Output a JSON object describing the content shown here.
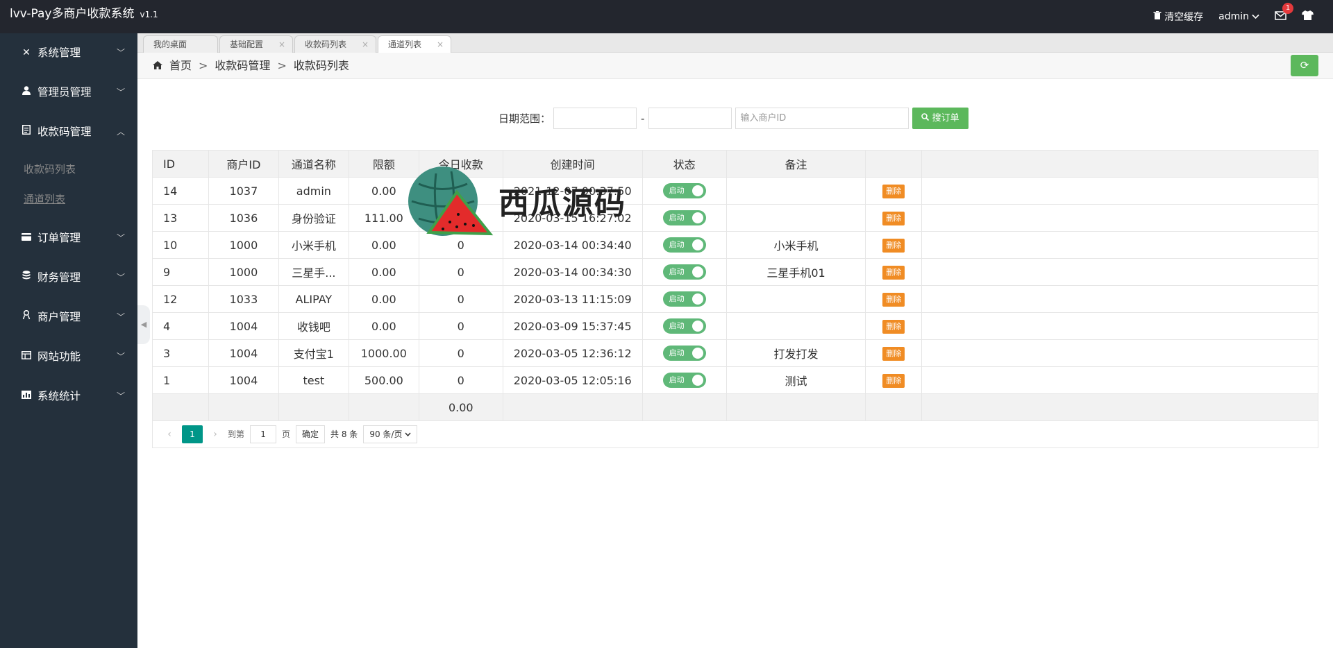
{
  "header": {
    "title": "lvv-Pay多商户收款系统",
    "version": "v1.1",
    "clear_cache": "清空缓存",
    "user": "admin",
    "mail_badge": "1"
  },
  "sidebar": {
    "items": [
      {
        "label": "系统管理",
        "icon": "wrench-icon"
      },
      {
        "label": "管理员管理",
        "icon": "user-icon"
      },
      {
        "label": "收款码管理",
        "icon": "list-icon"
      },
      {
        "label": "订单管理",
        "icon": "card-icon"
      },
      {
        "label": "财务管理",
        "icon": "database-icon"
      },
      {
        "label": "商户管理",
        "icon": "merchant-icon"
      },
      {
        "label": "网站功能",
        "icon": "layout-icon"
      },
      {
        "label": "系统统计",
        "icon": "stats-icon"
      }
    ],
    "submenu": [
      "收款码列表",
      "通道列表"
    ]
  },
  "tabs": [
    "我的桌面",
    "基础配置",
    "收款码列表",
    "通道列表"
  ],
  "breadcrumb": [
    "首页",
    "收款码管理",
    "收款码列表"
  ],
  "search": {
    "label": "日期范围：",
    "dash": "-",
    "merchant_placeholder": "输入商户ID",
    "button": "搜订单"
  },
  "table": {
    "headers": [
      "ID",
      "商户ID",
      "通道名称",
      "限额",
      "今日收款",
      "创建时间",
      "状态",
      "备注",
      ""
    ],
    "status_label": "启动",
    "delete_label": "删除",
    "rows": [
      {
        "id": "14",
        "merchant": "1037",
        "name": "admin",
        "limit": "0.00",
        "today": "",
        "created": "2021-12-07 00:37:50",
        "note": ""
      },
      {
        "id": "13",
        "merchant": "1036",
        "name": "身份验证",
        "limit": "111.00",
        "today": "",
        "created": "2020-03-15 16:27:02",
        "note": ""
      },
      {
        "id": "10",
        "merchant": "1000",
        "name": "小米手机",
        "limit": "0.00",
        "today": "0",
        "created": "2020-03-14 00:34:40",
        "note": "小米手机"
      },
      {
        "id": "9",
        "merchant": "1000",
        "name": "三星手...",
        "limit": "0.00",
        "today": "0",
        "created": "2020-03-14 00:34:30",
        "note": "三星手机01"
      },
      {
        "id": "12",
        "merchant": "1033",
        "name": "ALIPAY",
        "limit": "0.00",
        "today": "0",
        "created": "2020-03-13 11:15:09",
        "note": ""
      },
      {
        "id": "4",
        "merchant": "1004",
        "name": "收钱吧",
        "limit": "0.00",
        "today": "0",
        "created": "2020-03-09 15:37:45",
        "note": ""
      },
      {
        "id": "3",
        "merchant": "1004",
        "name": "支付宝1",
        "limit": "1000.00",
        "today": "0",
        "created": "2020-03-05 12:36:12",
        "note": "打发打发"
      },
      {
        "id": "1",
        "merchant": "1004",
        "name": "test",
        "limit": "500.00",
        "today": "0",
        "created": "2020-03-05 12:05:16",
        "note": "测试"
      }
    ],
    "total_today": "0.00"
  },
  "pager": {
    "current": "1",
    "goto_label": "到第",
    "goto_value": "1",
    "page_unit": "页",
    "confirm": "确定",
    "total": "共 8 条",
    "per_page": "90 条/页"
  },
  "watermark": "西瓜源码"
}
